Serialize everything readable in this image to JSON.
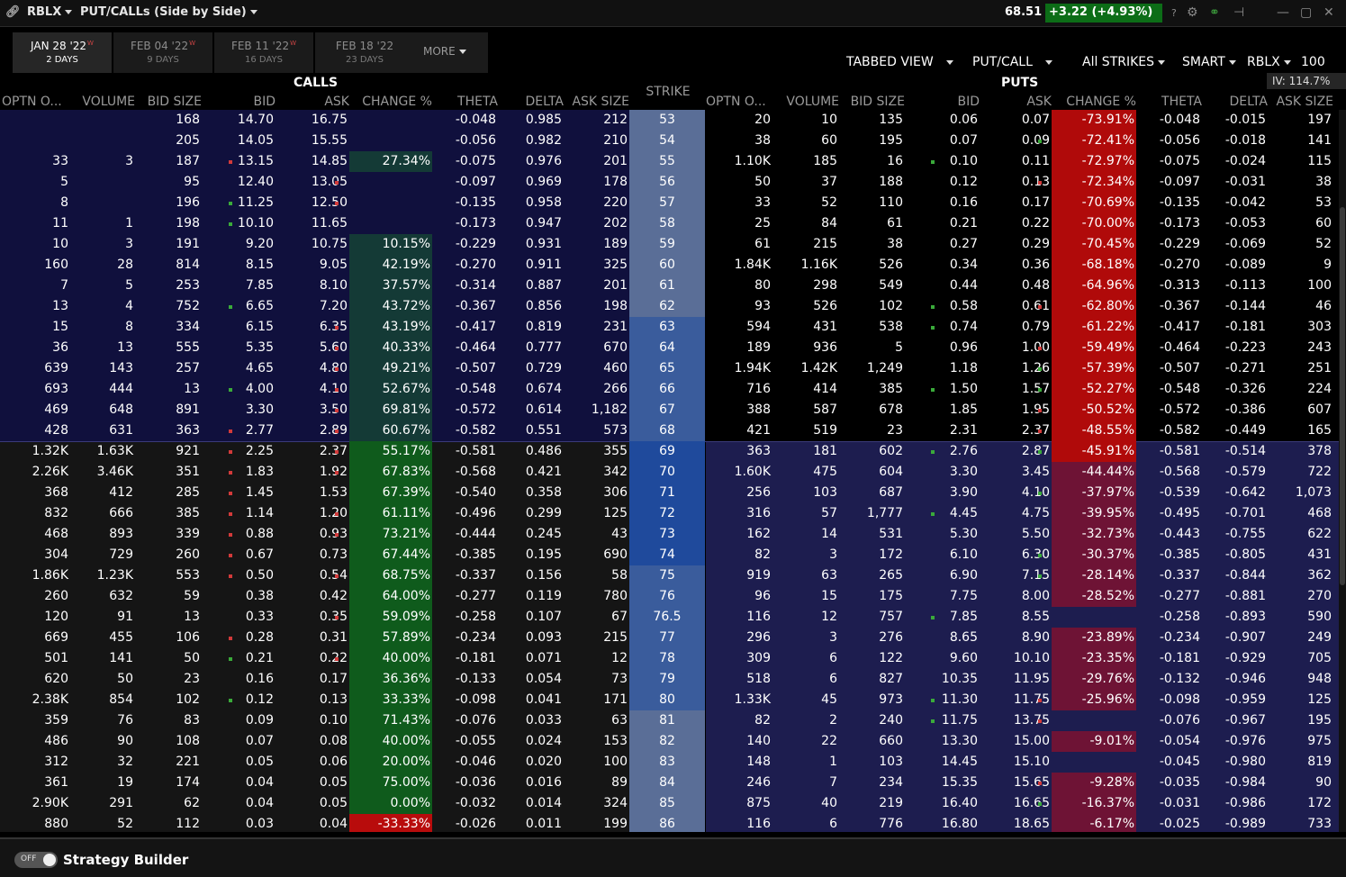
{
  "title": {
    "symbol": "RBLX",
    "view": "PUT/CALLs (Side by Side)"
  },
  "quote": {
    "last": "68.51",
    "change": "+3.22 (+4.93%)"
  },
  "icons": {
    "link": "chain-link-icon",
    "help": "question-icon",
    "settings": "gear-icon",
    "pin": "pin-icon",
    "minimize": "minimize-icon",
    "maximize": "maximize-icon",
    "close": "close-icon",
    "help_text": "?"
  },
  "tabs": [
    {
      "date": "JAN 28 '22",
      "flag": "W",
      "days": "2 DAYS"
    },
    {
      "date": "FEB 04 '22",
      "flag": "W",
      "days": "9 DAYS"
    },
    {
      "date": "FEB 11 '22",
      "flag": "W",
      "days": "16 DAYS"
    },
    {
      "date": "FEB 18 '22",
      "flag": "",
      "days": "23 DAYS"
    }
  ],
  "more_label": "MORE",
  "options": {
    "view": "TABBED VIEW",
    "type": "PUT/CALL",
    "strikes": "All STRIKES",
    "exchange": "SMART",
    "symbol": "RBLX",
    "size": "100"
  },
  "iv": "IV: 114.7%",
  "sections": {
    "calls": "CALLS",
    "puts": "PUTS",
    "strike": "STRIKE"
  },
  "columns": [
    "OPTN O...",
    "VOLUME",
    "BID SIZE",
    "BID",
    "ASK",
    "CHANGE %",
    "THETA",
    "DELTA",
    "ASK SIZE"
  ],
  "colors": {
    "itm_call": "#10103d",
    "otm_call": "#151515",
    "itm_put": "#1d1d4f",
    "otm_put": "#000000",
    "strike_light": "#5a6e97",
    "strike_mid": "#3a5c9c",
    "strike_dark": "#1f4a9c",
    "dot_red": "#d23a3a",
    "dot_green": "#3aaa3a"
  },
  "strikes": [
    "53",
    "54",
    "55",
    "56",
    "57",
    "58",
    "59",
    "60",
    "61",
    "62",
    "63",
    "64",
    "65",
    "66",
    "67",
    "68",
    "69",
    "70",
    "71",
    "72",
    "73",
    "74",
    "75",
    "76",
    "76.5",
    "77",
    "78",
    "79",
    "80",
    "81",
    "82",
    "83",
    "84",
    "85",
    "86"
  ],
  "calls": [
    [
      "",
      "",
      "168",
      "14.70",
      "16.75",
      "",
      "-0.048",
      "0.985",
      "212"
    ],
    [
      "",
      "",
      "205",
      "14.05",
      "15.55",
      "",
      "-0.056",
      "0.982",
      "210"
    ],
    [
      "33",
      "3",
      "187",
      "13.15",
      "14.85",
      "27.34%",
      "-0.075",
      "0.976",
      "201"
    ],
    [
      "5",
      "",
      "95",
      "12.40",
      "13.05",
      "",
      "-0.097",
      "0.969",
      "178"
    ],
    [
      "8",
      "",
      "196",
      "11.25",
      "12.50",
      "",
      "-0.135",
      "0.958",
      "220"
    ],
    [
      "11",
      "1",
      "198",
      "10.10",
      "11.65",
      "",
      "-0.173",
      "0.947",
      "202"
    ],
    [
      "10",
      "3",
      "191",
      "9.20",
      "10.75",
      "10.15%",
      "-0.229",
      "0.931",
      "189"
    ],
    [
      "160",
      "28",
      "814",
      "8.15",
      "9.05",
      "42.19%",
      "-0.270",
      "0.911",
      "325"
    ],
    [
      "7",
      "5",
      "253",
      "7.85",
      "8.10",
      "37.57%",
      "-0.314",
      "0.887",
      "201"
    ],
    [
      "13",
      "4",
      "752",
      "6.65",
      "7.20",
      "43.72%",
      "-0.367",
      "0.856",
      "198"
    ],
    [
      "15",
      "8",
      "334",
      "6.15",
      "6.35",
      "43.19%",
      "-0.417",
      "0.819",
      "231"
    ],
    [
      "36",
      "13",
      "555",
      "5.35",
      "5.60",
      "40.33%",
      "-0.464",
      "0.777",
      "670"
    ],
    [
      "639",
      "143",
      "257",
      "4.65",
      "4.80",
      "49.21%",
      "-0.507",
      "0.729",
      "460"
    ],
    [
      "693",
      "444",
      "13",
      "4.00",
      "4.10",
      "52.67%",
      "-0.548",
      "0.674",
      "266"
    ],
    [
      "469",
      "648",
      "891",
      "3.30",
      "3.50",
      "69.81%",
      "-0.572",
      "0.614",
      "1,182"
    ],
    [
      "428",
      "631",
      "363",
      "2.77",
      "2.89",
      "60.67%",
      "-0.582",
      "0.551",
      "573"
    ],
    [
      "1.32K",
      "1.63K",
      "921",
      "2.25",
      "2.37",
      "55.17%",
      "-0.581",
      "0.486",
      "355"
    ],
    [
      "2.26K",
      "3.46K",
      "351",
      "1.83",
      "1.92",
      "67.83%",
      "-0.568",
      "0.421",
      "342"
    ],
    [
      "368",
      "412",
      "285",
      "1.45",
      "1.53",
      "67.39%",
      "-0.540",
      "0.358",
      "306"
    ],
    [
      "832",
      "666",
      "385",
      "1.14",
      "1.20",
      "61.11%",
      "-0.496",
      "0.299",
      "125"
    ],
    [
      "468",
      "893",
      "339",
      "0.88",
      "0.93",
      "73.21%",
      "-0.444",
      "0.245",
      "43"
    ],
    [
      "304",
      "729",
      "260",
      "0.67",
      "0.73",
      "67.44%",
      "-0.385",
      "0.195",
      "690"
    ],
    [
      "1.86K",
      "1.23K",
      "553",
      "0.50",
      "0.54",
      "68.75%",
      "-0.337",
      "0.156",
      "58"
    ],
    [
      "260",
      "632",
      "59",
      "0.38",
      "0.42",
      "64.00%",
      "-0.277",
      "0.119",
      "780"
    ],
    [
      "120",
      "91",
      "13",
      "0.33",
      "0.35",
      "59.09%",
      "-0.258",
      "0.107",
      "67"
    ],
    [
      "669",
      "455",
      "106",
      "0.28",
      "0.31",
      "57.89%",
      "-0.234",
      "0.093",
      "215"
    ],
    [
      "501",
      "141",
      "50",
      "0.21",
      "0.22",
      "40.00%",
      "-0.181",
      "0.071",
      "12"
    ],
    [
      "620",
      "50",
      "23",
      "0.16",
      "0.17",
      "36.36%",
      "-0.133",
      "0.054",
      "73"
    ],
    [
      "2.38K",
      "854",
      "102",
      "0.12",
      "0.13",
      "33.33%",
      "-0.098",
      "0.041",
      "171"
    ],
    [
      "359",
      "76",
      "83",
      "0.09",
      "0.10",
      "71.43%",
      "-0.076",
      "0.033",
      "63"
    ],
    [
      "486",
      "90",
      "108",
      "0.07",
      "0.08",
      "40.00%",
      "-0.055",
      "0.024",
      "153"
    ],
    [
      "312",
      "32",
      "221",
      "0.05",
      "0.06",
      "20.00%",
      "-0.046",
      "0.020",
      "100"
    ],
    [
      "361",
      "19",
      "174",
      "0.04",
      "0.05",
      "75.00%",
      "-0.036",
      "0.016",
      "89"
    ],
    [
      "2.90K",
      "291",
      "62",
      "0.04",
      "0.05",
      "0.00%",
      "-0.032",
      "0.014",
      "324"
    ],
    [
      "880",
      "52",
      "112",
      "0.03",
      "0.04",
      "-33.33%",
      "-0.026",
      "0.011",
      "199"
    ]
  ],
  "puts": [
    [
      "20",
      "10",
      "135",
      "0.06",
      "0.07",
      "-73.91%",
      "-0.048",
      "-0.015",
      "197"
    ],
    [
      "38",
      "60",
      "195",
      "0.07",
      "0.09",
      "-72.41%",
      "-0.056",
      "-0.018",
      "141"
    ],
    [
      "1.10K",
      "185",
      "16",
      "0.10",
      "0.11",
      "-72.97%",
      "-0.075",
      "-0.024",
      "115"
    ],
    [
      "50",
      "37",
      "188",
      "0.12",
      "0.13",
      "-72.34%",
      "-0.097",
      "-0.031",
      "38"
    ],
    [
      "33",
      "52",
      "110",
      "0.16",
      "0.17",
      "-70.69%",
      "-0.135",
      "-0.042",
      "53"
    ],
    [
      "25",
      "84",
      "61",
      "0.21",
      "0.22",
      "-70.00%",
      "-0.173",
      "-0.053",
      "60"
    ],
    [
      "61",
      "215",
      "38",
      "0.27",
      "0.29",
      "-70.45%",
      "-0.229",
      "-0.069",
      "52"
    ],
    [
      "1.84K",
      "1.16K",
      "526",
      "0.34",
      "0.36",
      "-68.18%",
      "-0.270",
      "-0.089",
      "9"
    ],
    [
      "80",
      "298",
      "549",
      "0.44",
      "0.48",
      "-64.96%",
      "-0.313",
      "-0.113",
      "100"
    ],
    [
      "93",
      "526",
      "102",
      "0.58",
      "0.61",
      "-62.80%",
      "-0.367",
      "-0.144",
      "46"
    ],
    [
      "594",
      "431",
      "538",
      "0.74",
      "0.79",
      "-61.22%",
      "-0.417",
      "-0.181",
      "303"
    ],
    [
      "189",
      "936",
      "5",
      "0.96",
      "1.00",
      "-59.49%",
      "-0.464",
      "-0.223",
      "243"
    ],
    [
      "1.94K",
      "1.42K",
      "1,249",
      "1.18",
      "1.26",
      "-57.39%",
      "-0.507",
      "-0.271",
      "251"
    ],
    [
      "716",
      "414",
      "385",
      "1.50",
      "1.57",
      "-52.27%",
      "-0.548",
      "-0.326",
      "224"
    ],
    [
      "388",
      "587",
      "678",
      "1.85",
      "1.95",
      "-50.52%",
      "-0.572",
      "-0.386",
      "607"
    ],
    [
      "421",
      "519",
      "23",
      "2.31",
      "2.37",
      "-48.55%",
      "-0.582",
      "-0.449",
      "165"
    ],
    [
      "363",
      "181",
      "602",
      "2.76",
      "2.87",
      "-45.91%",
      "-0.581",
      "-0.514",
      "378"
    ],
    [
      "1.60K",
      "475",
      "604",
      "3.30",
      "3.45",
      "-44.44%",
      "-0.568",
      "-0.579",
      "722"
    ],
    [
      "256",
      "103",
      "687",
      "3.90",
      "4.10",
      "-37.97%",
      "-0.539",
      "-0.642",
      "1,073"
    ],
    [
      "316",
      "57",
      "1,777",
      "4.45",
      "4.75",
      "-39.95%",
      "-0.495",
      "-0.701",
      "468"
    ],
    [
      "162",
      "14",
      "531",
      "5.30",
      "5.50",
      "-32.73%",
      "-0.443",
      "-0.755",
      "622"
    ],
    [
      "82",
      "3",
      "172",
      "6.10",
      "6.30",
      "-30.37%",
      "-0.385",
      "-0.805",
      "431"
    ],
    [
      "919",
      "63",
      "265",
      "6.90",
      "7.15",
      "-28.14%",
      "-0.337",
      "-0.844",
      "362"
    ],
    [
      "96",
      "15",
      "175",
      "7.75",
      "8.00",
      "-28.52%",
      "-0.277",
      "-0.881",
      "270"
    ],
    [
      "116",
      "12",
      "757",
      "7.85",
      "8.55",
      "",
      "-0.258",
      "-0.893",
      "590"
    ],
    [
      "296",
      "3",
      "276",
      "8.65",
      "8.90",
      "-23.89%",
      "-0.234",
      "-0.907",
      "249"
    ],
    [
      "309",
      "6",
      "122",
      "9.60",
      "10.10",
      "-23.35%",
      "-0.181",
      "-0.929",
      "705"
    ],
    [
      "518",
      "6",
      "827",
      "10.35",
      "11.95",
      "-29.76%",
      "-0.132",
      "-0.946",
      "948"
    ],
    [
      "1.33K",
      "45",
      "973",
      "11.30",
      "11.75",
      "-25.96%",
      "-0.098",
      "-0.959",
      "125"
    ],
    [
      "82",
      "2",
      "240",
      "11.75",
      "13.75",
      "",
      "-0.076",
      "-0.967",
      "195"
    ],
    [
      "140",
      "22",
      "660",
      "13.30",
      "15.00",
      "-9.01%",
      "-0.054",
      "-0.976",
      "975"
    ],
    [
      "148",
      "1",
      "103",
      "14.45",
      "15.10",
      "",
      "-0.045",
      "-0.980",
      "819"
    ],
    [
      "246",
      "7",
      "234",
      "15.35",
      "15.65",
      "-9.28%",
      "-0.035",
      "-0.984",
      "90"
    ],
    [
      "875",
      "40",
      "219",
      "16.40",
      "16.65",
      "-16.37%",
      "-0.031",
      "-0.986",
      "172"
    ],
    [
      "116",
      "6",
      "776",
      "16.80",
      "18.65",
      "-6.17%",
      "-0.025",
      "-0.989",
      "733"
    ]
  ],
  "footer": {
    "toggle": "OFF",
    "label": "Strategy Builder"
  }
}
